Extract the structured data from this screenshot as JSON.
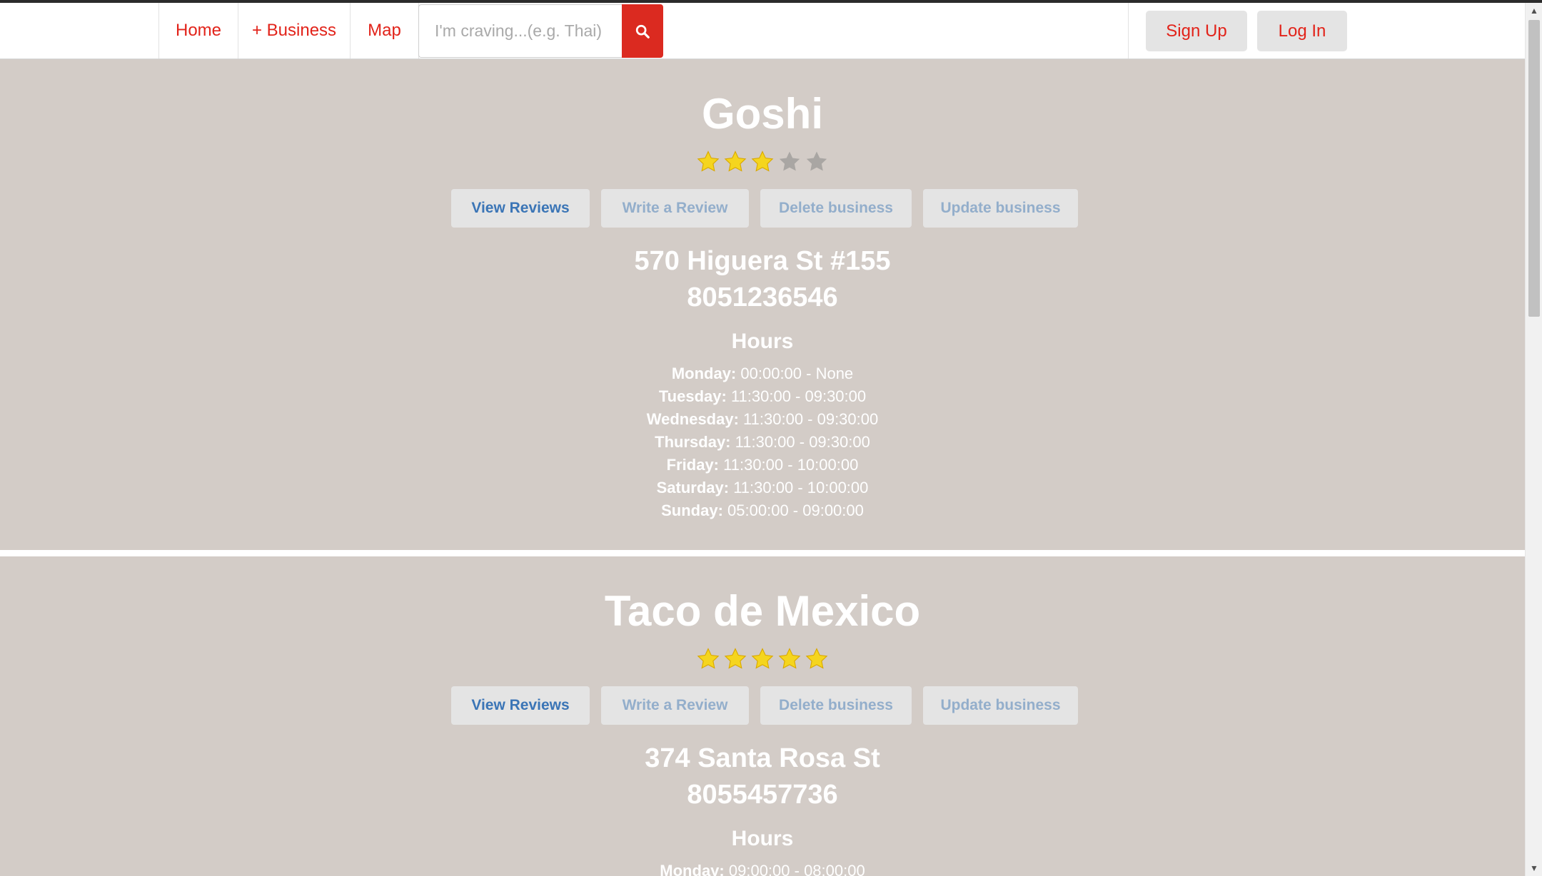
{
  "nav": {
    "links": [
      "Home",
      "+ Business",
      "Map"
    ],
    "search_placeholder": "I'm craving...(e.g. Thai)",
    "search_icon": "search-icon",
    "signup": "Sign Up",
    "login": "Log In"
  },
  "colors": {
    "brand_red": "#e2231a",
    "page_bg": "#d3ccc7",
    "action_blue": "#3b75b6",
    "action_muted": "#93aecb",
    "star_gold": "#f5d51e",
    "star_empty": "#a9a6a3"
  },
  "actions": {
    "view_reviews": "View Reviews",
    "write_review": "Write a Review",
    "delete_business": "Delete business",
    "update_business": "Update business"
  },
  "hours_title": "Hours",
  "businesses": [
    {
      "name": "Goshi",
      "rating": 3,
      "rating_max": 5,
      "address": "570 Higuera St #155",
      "phone": "8051236546",
      "hours": [
        {
          "day": "Monday:",
          "time": "00:00:00 - None"
        },
        {
          "day": "Tuesday:",
          "time": "11:30:00 - 09:30:00"
        },
        {
          "day": "Wednesday:",
          "time": "11:30:00 - 09:30:00"
        },
        {
          "day": "Thursday:",
          "time": "11:30:00 - 09:30:00"
        },
        {
          "day": "Friday:",
          "time": "11:30:00 - 10:00:00"
        },
        {
          "day": "Saturday:",
          "time": "11:30:00 - 10:00:00"
        },
        {
          "day": "Sunday:",
          "time": "05:00:00 - 09:00:00"
        }
      ]
    },
    {
      "name": "Taco de Mexico",
      "rating": 5,
      "rating_max": 5,
      "address": "374 Santa Rosa St",
      "phone": "8055457736",
      "hours": [
        {
          "day": "Monday:",
          "time": "09:00:00 - 08:00:00"
        }
      ]
    }
  ]
}
